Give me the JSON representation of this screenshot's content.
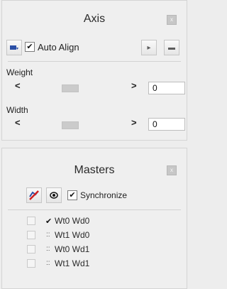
{
  "axis_panel": {
    "title": "Axis",
    "close_glyph": "x",
    "auto_align_label": "Auto Align",
    "auto_align_checked": true,
    "toolbar_icons": [
      "axis-edit-icon",
      "next-icon",
      "minus-icon"
    ],
    "weight": {
      "label": "Weight",
      "left_arrow": "<",
      "right_arrow": ">",
      "value": "0"
    },
    "width": {
      "label": "Width",
      "left_arrow": "<",
      "right_arrow": ">",
      "value": "0"
    }
  },
  "masters_panel": {
    "title": "Masters",
    "close_glyph": "x",
    "synchronize_label": "Synchronize",
    "synchronize_checked": true,
    "toolbar_icons": [
      "no-masters-icon",
      "preview-icon"
    ],
    "masters": [
      {
        "label": "Wt0 Wd0",
        "status": "✔",
        "active": true
      },
      {
        "label": "Wt1 Wd0",
        "status": "::",
        "active": false
      },
      {
        "label": "Wt0 Wd1",
        "status": "::",
        "active": false
      },
      {
        "label": "Wt1 Wd1",
        "status": "::",
        "active": false
      }
    ]
  }
}
